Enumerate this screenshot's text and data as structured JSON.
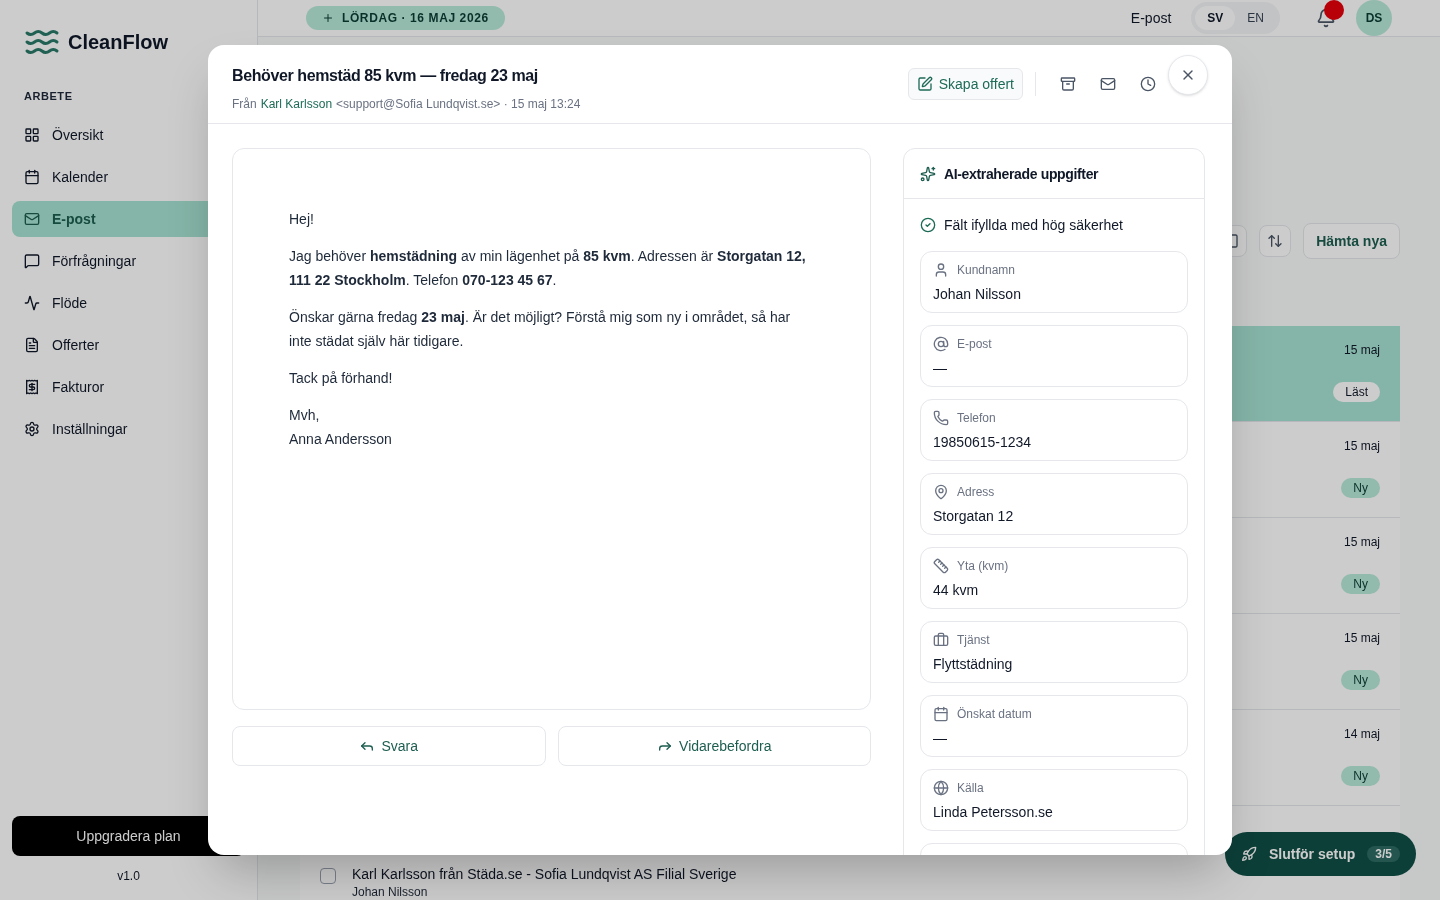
{
  "background": {
    "brand": "CleanFlow",
    "sidebar_section": "ARBETE",
    "nav": [
      {
        "kind": "grid",
        "label": "Översikt",
        "selected": false
      },
      {
        "kind": "calendar",
        "label": "Kalender",
        "selected": false
      },
      {
        "kind": "mail",
        "label": "E-post",
        "selected": true
      },
      {
        "kind": "chat",
        "label": "Förfrågningar",
        "selected": false
      },
      {
        "kind": "activity",
        "label": "Flöde",
        "selected": false
      },
      {
        "kind": "file",
        "label": "Offerter",
        "selected": false
      },
      {
        "kind": "receipt",
        "label": "Fakturor",
        "selected": false
      },
      {
        "kind": "settings",
        "label": "Inställningar",
        "selected": false
      }
    ],
    "upgrade_button": "Uppgradera plan",
    "version": "v1.0",
    "date_pill": "LÖRDAG · 16 MAJ 2026",
    "topbar": {
      "section": "E-post",
      "languages": [
        {
          "label": "SV",
          "selected": true
        },
        {
          "label": "EN",
          "selected": false
        }
      ],
      "notification": true,
      "avatar": "DS"
    },
    "refresh_button": "Hämta nya",
    "rows": [
      {
        "date": "15 maj",
        "badge": "Läst",
        "selected": true
      },
      {
        "date": "15 maj",
        "badge": "Ny",
        "selected": false
      },
      {
        "date": "15 maj",
        "badge": "Ny",
        "selected": false
      },
      {
        "date": "15 maj",
        "badge": "Ny",
        "selected": false
      },
      {
        "date": "14 maj",
        "badge": "Ny",
        "selected": false
      },
      {
        "snippet": "Karl Karlsson från Städa.se - Sofia Lundqvist AS Filial Sverige",
        "name": "Johan Nilsson",
        "selected": false
      }
    ],
    "setup_button": {
      "label": "Slutför setup",
      "progress": "3/5"
    }
  },
  "modal": {
    "subject": "Behöver hemstäd 85 kvm — fredag 23 maj",
    "from_label": "Från",
    "sender": "Karl Karlsson",
    "meta": "<support@Sofia Lundqvist.se> · 15 maj 13:24",
    "create_quote": "Skapa offert",
    "body": [
      "Hej!",
      "Jag behöver **hemstädning** av min lägenhet på **85 kvm**. Adressen är **Storgatan 12, 111 22 Stockholm**. Telefon **070-123 45 67**.",
      "Önskar gärna fredag **23 maj**. Är det möjligt? Förstå mig som ny i området, så har inte städat själv här tidigare.",
      "Tack på förhand!",
      "Mvh,\nAnna Andersson"
    ],
    "reply": "Svara",
    "forward": "Vidarebefordra",
    "ai_title": "AI-extraherade uppgifter",
    "confidence": "Fält ifyllda med hög säkerhet",
    "fields": [
      {
        "kind": "person",
        "label": "Kundnamn",
        "value": "Johan Nilsson"
      },
      {
        "kind": "email",
        "label": "E-post",
        "value": "—"
      },
      {
        "kind": "phone",
        "label": "Telefon",
        "value": "19850615-1234"
      },
      {
        "kind": "address",
        "label": "Adress",
        "value": "Storgatan 12"
      },
      {
        "kind": "area",
        "label": "Yta (kvm)",
        "value": "44 kvm"
      },
      {
        "kind": "service",
        "label": "Tjänst",
        "value": "Flyttstädning"
      },
      {
        "kind": "date",
        "label": "Önskat datum",
        "value": "—"
      },
      {
        "kind": "source",
        "label": "Källa",
        "value": "Linda Petersson.se"
      }
    ]
  }
}
